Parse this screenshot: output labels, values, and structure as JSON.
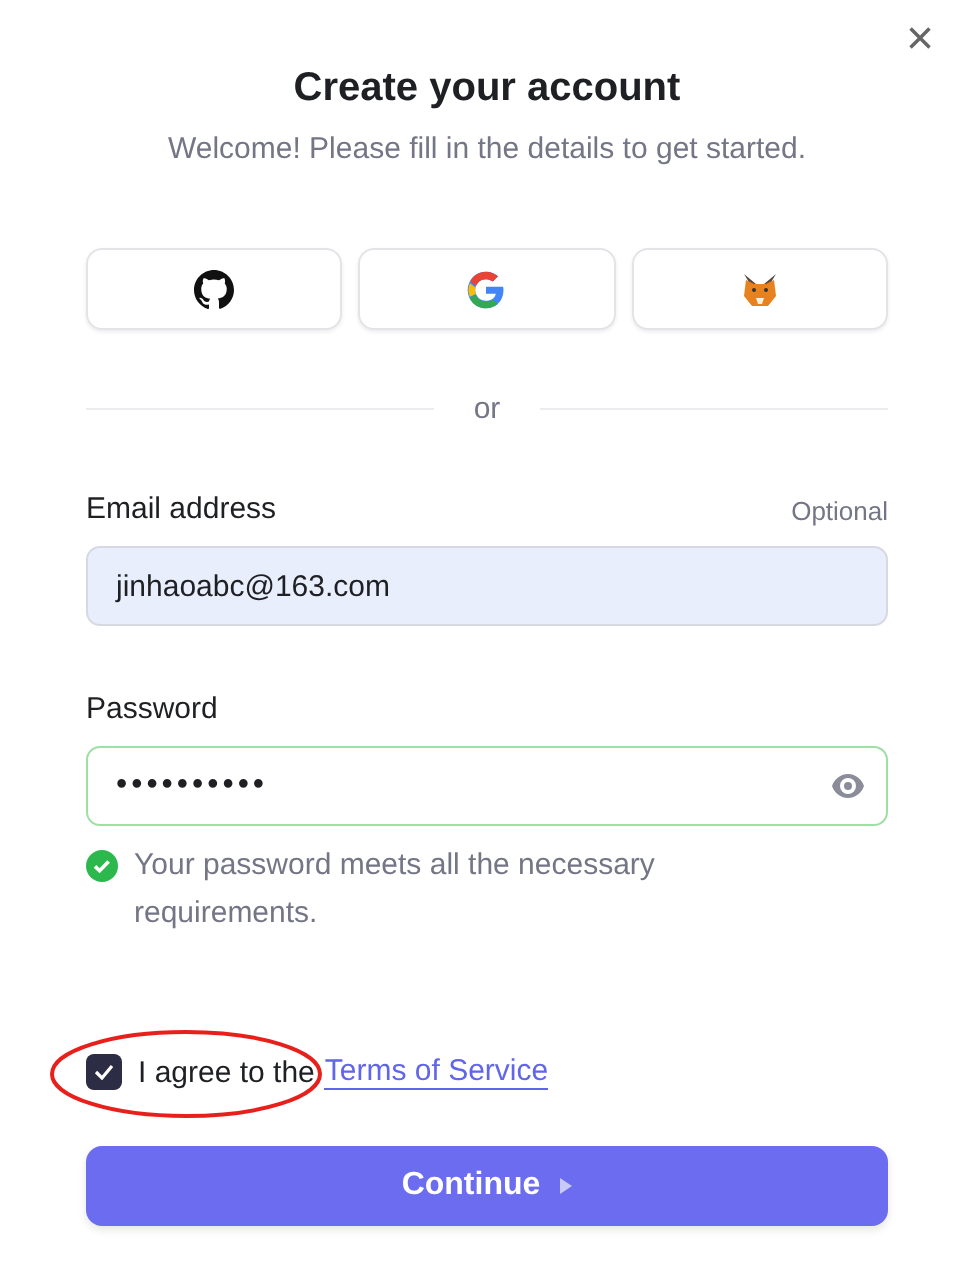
{
  "close": "×",
  "title": "Create your account",
  "subtitle": "Welcome! Please fill in the details to get started.",
  "social_buttons": [
    {
      "kind": "github"
    },
    {
      "kind": "google"
    },
    {
      "kind": "fox"
    }
  ],
  "divider": "or",
  "email": {
    "label": "Email address",
    "hint": "Optional",
    "value": "jinhaoabc@163.com"
  },
  "password": {
    "label": "Password",
    "value": "••••••••••",
    "valid": true,
    "message": "Your password meets all the necessary requirements."
  },
  "terms": {
    "checked": true,
    "text": "I agree to the",
    "link": "Terms of Service"
  },
  "annotation": {
    "kind": "ellipse"
  },
  "continue_button": "Continue"
}
